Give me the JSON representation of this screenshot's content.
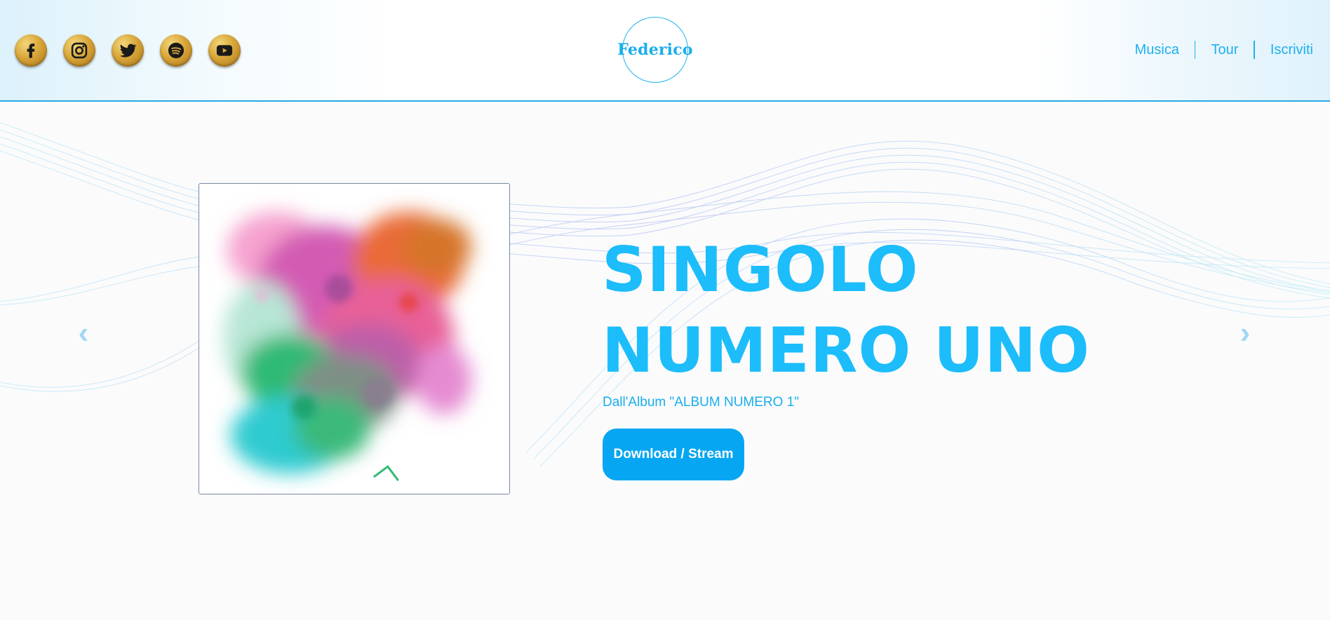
{
  "header": {
    "social": [
      {
        "name": "facebook",
        "icon": "facebook-icon"
      },
      {
        "name": "instagram",
        "icon": "instagram-icon"
      },
      {
        "name": "twitter",
        "icon": "twitter-icon"
      },
      {
        "name": "spotify",
        "icon": "spotify-icon"
      },
      {
        "name": "youtube",
        "icon": "youtube-icon"
      }
    ],
    "logo_text": "Federico",
    "nav": {
      "musica": "Musica",
      "tour": "Tour",
      "iscriviti": "Iscriviti"
    }
  },
  "hero": {
    "title_line1": "SINGOLO",
    "title_line2": "NUMERO UNO",
    "subtitle": "Dall'Album \"ALBUM NUMERO 1\"",
    "cta_label": "Download / Stream",
    "prev_arrow": "‹",
    "next_arrow": "›",
    "cover_icon": "paint-splash-artwork"
  },
  "colors": {
    "accent": "#1cbdfa",
    "button": "#07a6f2",
    "header_border": "#27a9e4",
    "gold": "#d9a63a"
  }
}
